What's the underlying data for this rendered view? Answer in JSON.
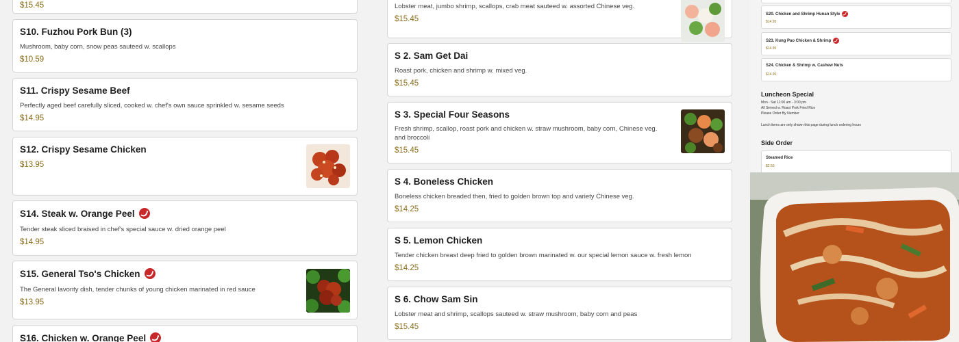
{
  "column1": {
    "top_price": "$15.45",
    "items": [
      {
        "name": "S10. Fuzhou Pork Bun (3)",
        "desc": "Mushroom, baby corn, snow peas sauteed w. scallops",
        "price": "$10.59",
        "spicy": false
      },
      {
        "name": "S11. Crispy Sesame Beef",
        "desc": "Perfectly aged beef carefully sliced, cooked w. chef's own sauce sprinkled w. sesame seeds",
        "price": "$14.95",
        "spicy": false
      },
      {
        "name": "S12. Crispy Sesame Chicken",
        "desc": "",
        "price": "$13.95",
        "spicy": false,
        "image": "sesame-chicken"
      },
      {
        "name": "S14. Steak w. Orange Peel",
        "desc": "Tender steak sliced braised in chef's special sauce w. dried orange peel",
        "price": "$14.95",
        "spicy": true
      },
      {
        "name": "S15. General Tso's Chicken",
        "desc": "The General lavonty dish, tender chunks of young chicken marinated in red sauce",
        "price": "$13.95",
        "spicy": true,
        "image": "general-tso"
      },
      {
        "name": "S16. Chicken w. Orange Peel",
        "desc": "",
        "price": "",
        "spicy": true
      }
    ]
  },
  "column2": {
    "top_desc": "Lobster meat, jumbo shrimp, scallops, crab meat sauteed w. assorted Chinese veg.",
    "top_price": "$15.45",
    "items": [
      {
        "name": "S 2. Sam Get Dai",
        "desc": "Roast pork, chicken and shrimp w. mixed veg.",
        "price": "$15.45"
      },
      {
        "name": "S 3. Special Four Seasons",
        "desc": "Fresh shrimp, scallop, roast pork and chicken w. straw mushroom, baby corn, Chinese veg. and broccoli",
        "price": "$15.45",
        "image": "four-seasons"
      },
      {
        "name": "S 4. Boneless Chicken",
        "desc": "Boneless chicken breaded then, fried to golden brown top and variety Chinese veg.",
        "price": "$14.25"
      },
      {
        "name": "S 5. Lemon Chicken",
        "desc": "Tender chicken breast deep fried to golden brown marinated w. our special lemon sauce w. fresh lemon",
        "price": "$14.25"
      },
      {
        "name": "S 6. Chow Sam Sin",
        "desc": "Lobster meat and shrimp, scallops sauteed w. straw mushroom, baby corn and peas",
        "price": "$15.45"
      }
    ]
  },
  "column3": {
    "items": [
      {
        "name": "S20. Chicken and Shrimp Hunan Style",
        "price": "$14.95",
        "spicy": true
      },
      {
        "name": "S23. Kung Pao Chicken & Shrimp",
        "price": "$14.95",
        "spicy": true
      },
      {
        "name": "S24. Chicken & Shrimp w. Cashew Nuts",
        "price": "$14.95",
        "spicy": false
      }
    ],
    "luncheon_title": "Luncheon Special",
    "luncheon_lines": [
      "Mon - Sat 11:00 am - 3:00 pm",
      "All Served w. Roast Pork Fried Rice",
      "Please Order By Number"
    ],
    "luncheon_note": "Lunch items are only shown this page during lunch ordering hours",
    "side_title": "Side Order",
    "side_item": {
      "name": "Steamed Rice",
      "price": "$2.50"
    }
  },
  "colors": {
    "price": "#8a6d1a",
    "spicy": "#c8282a",
    "card_border": "#d6d6d6"
  }
}
